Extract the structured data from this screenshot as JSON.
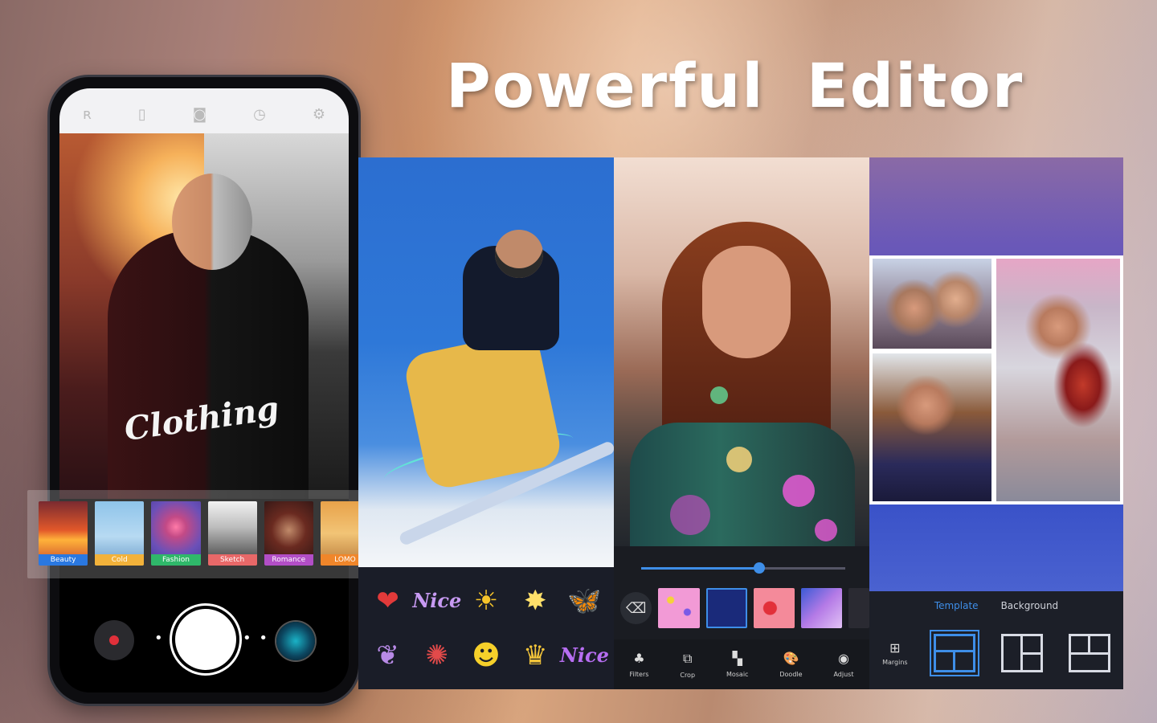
{
  "headline": {
    "title": "Powerful  Editor"
  },
  "phone": {
    "top_bar_icons": [
      "lightning-icon",
      "ratio-icon",
      "camera-icon",
      "timer-icon",
      "settings-icon"
    ],
    "top_bar_glyphs": [
      "ʀ",
      "▯",
      "◙",
      "◷",
      "⚙"
    ],
    "shirt_text": "Clothing",
    "filters": [
      {
        "label": "Beauty",
        "color": "#2a78e0"
      },
      {
        "label": "Cold",
        "color": "#f2b23a"
      },
      {
        "label": "Fashion",
        "color": "#2fb86a"
      },
      {
        "label": "Sketch",
        "color": "#e86868"
      },
      {
        "label": "Romance",
        "color": "#b24ec6"
      },
      {
        "label": "LOMO",
        "color": "#f0862a"
      }
    ],
    "dots": "• •"
  },
  "panel1": {
    "stickers_row1": [
      "❤",
      "Nice",
      "☀",
      "✸",
      "🦋"
    ],
    "stickers_row2": [
      "❦",
      "✺",
      "☻",
      "♛",
      "Nice"
    ]
  },
  "panel2": {
    "eraser_glyph": "⌫",
    "tools": [
      {
        "label": "Filters",
        "glyph": "♣"
      },
      {
        "label": "Crop",
        "glyph": "⧉"
      },
      {
        "label": "Mosaic",
        "glyph": "▚"
      },
      {
        "label": "Doodle",
        "glyph": "🎨"
      },
      {
        "label": "Adjust",
        "glyph": "◉"
      }
    ]
  },
  "panel3": {
    "tabs": {
      "template": "Template",
      "background": "Background"
    },
    "margins": {
      "label": "Margins",
      "glyph": "⊞"
    }
  },
  "colors": {
    "accent": "#3e8ee8"
  }
}
